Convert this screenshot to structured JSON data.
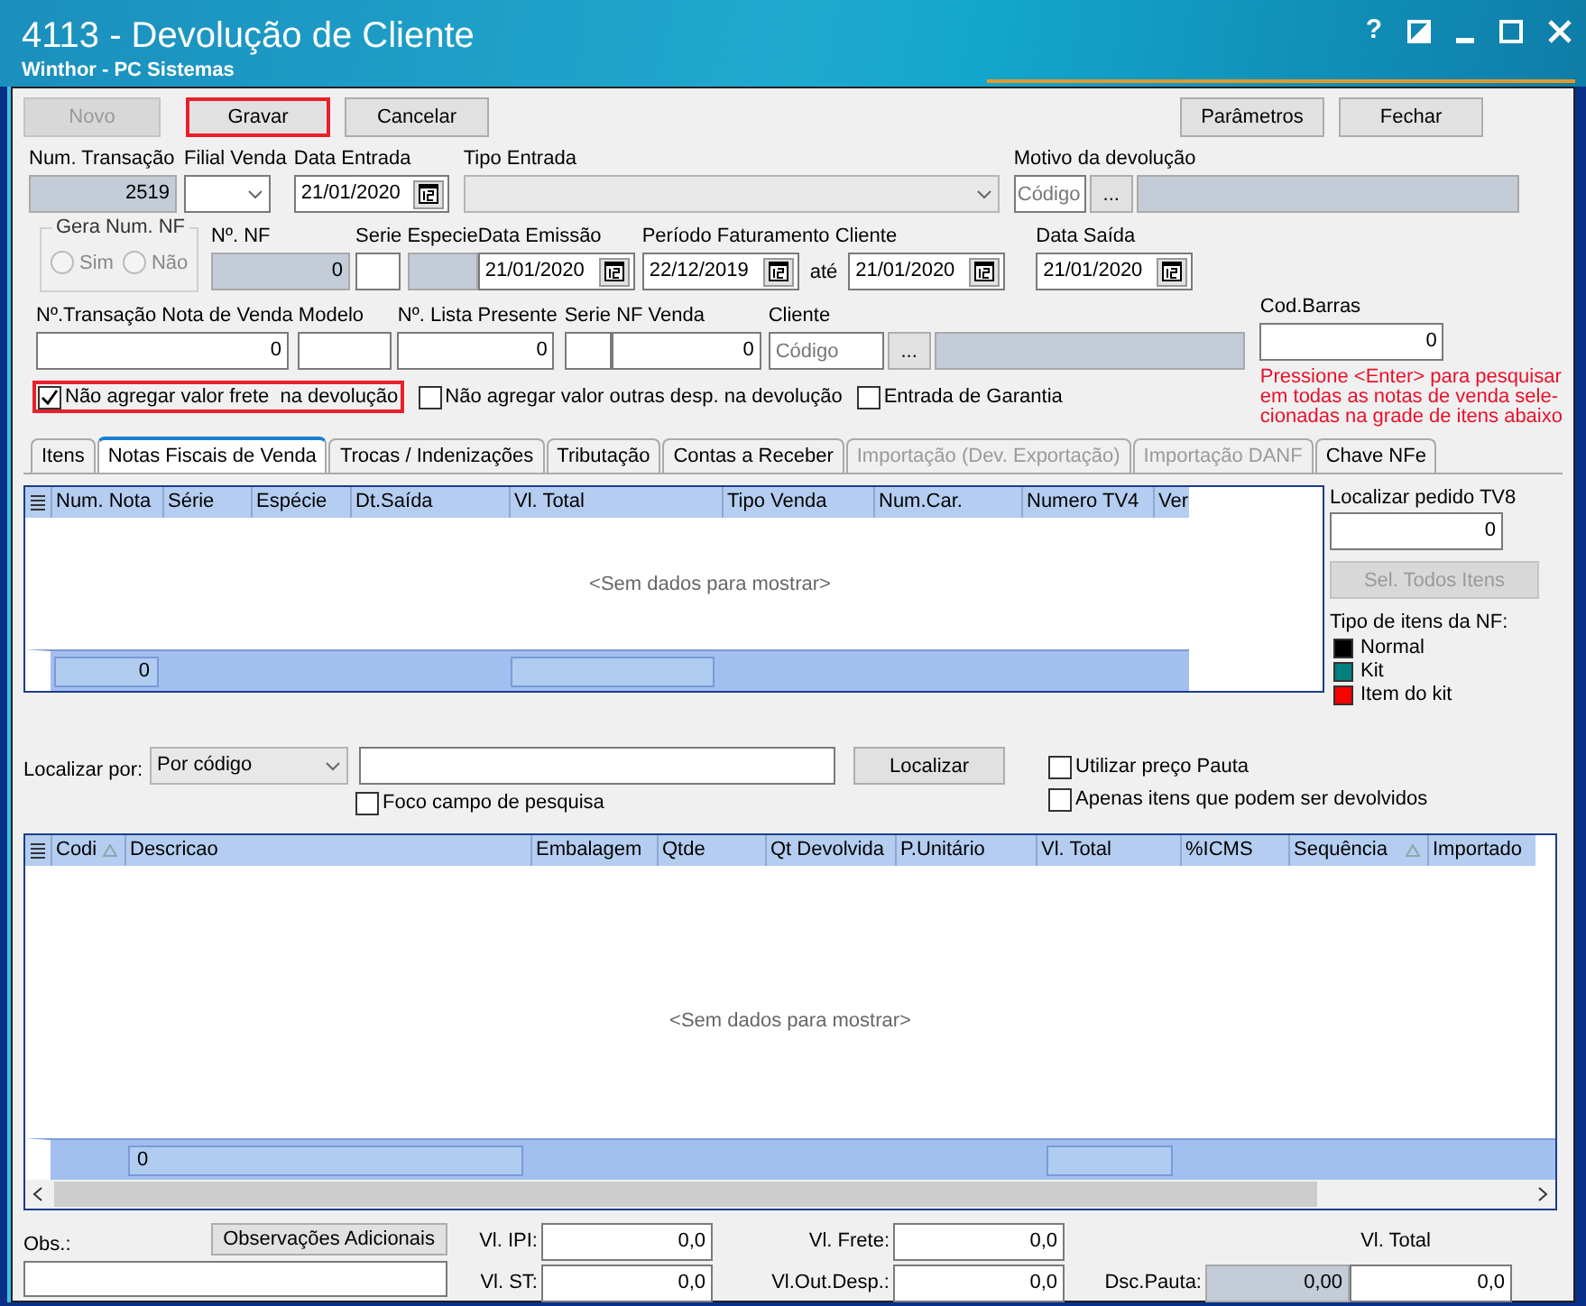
{
  "window": {
    "title": "4113 - Devolução de Cliente",
    "subtitle": "Winthor - PC Sistemas",
    "help": "?"
  },
  "toolbar": {
    "left": [
      {
        "label": "Novo",
        "disabled": true,
        "highlighted": false
      },
      {
        "label": "Gravar",
        "disabled": false,
        "highlighted": true
      },
      {
        "label": "Cancelar",
        "disabled": false,
        "highlighted": false
      }
    ],
    "right": [
      {
        "label": "Parâmetros",
        "disabled": false,
        "highlighted": false
      },
      {
        "label": "Fechar",
        "disabled": false,
        "highlighted": false
      }
    ]
  },
  "fields": {
    "num_transacao": {
      "label": "Num. Transação",
      "value": "2519"
    },
    "filial_venda": {
      "label": "Filial Venda"
    },
    "data_entrada": {
      "label": "Data Entrada",
      "value": "21/01/2020"
    },
    "tipo_entrada": {
      "label": "Tipo Entrada"
    },
    "motivo": {
      "label": "Motivo da devolução",
      "placeholder": "Código",
      "lookup": "..."
    },
    "gera_num_nf": {
      "label": "Gera Num. NF",
      "options": [
        {
          "label": "Sim",
          "selected": false
        },
        {
          "label": "Não",
          "selected": false
        }
      ]
    },
    "num_nf": {
      "label": "Nº. NF",
      "value": "0"
    },
    "serie": {
      "label": "Serie"
    },
    "especie": {
      "label": "Especie"
    },
    "data_emissao": {
      "label": "Data Emissão",
      "value": "21/01/2020"
    },
    "periodo": {
      "label": "Período Faturamento Cliente",
      "from": "22/12/2019",
      "separator": "até",
      "to": "21/01/2020"
    },
    "data_saida": {
      "label": "Data Saída",
      "value": "21/01/2020"
    },
    "transacao_nota_venda": {
      "label": "Nº.Transação Nota de Venda",
      "value": "0"
    },
    "modelo": {
      "label": "Modelo"
    },
    "lista_presente": {
      "label": "Nº. Lista Presente",
      "value": "0"
    },
    "serie_nf_venda": {
      "label": "Serie NF Venda",
      "value": "0"
    },
    "cliente": {
      "label": "Cliente",
      "placeholder": "Código",
      "lookup": "..."
    },
    "cod_barras": {
      "label": "Cod.Barras",
      "value": "0",
      "hint": [
        "Pressione <Enter> para pesquisar",
        "em todas as notas de venda sele-",
        "cionadas na grade de itens abaixo"
      ]
    }
  },
  "options": [
    {
      "label": "Não agregar valor frete  na devolução",
      "checked": true,
      "highlighted": true
    },
    {
      "label": "Não agregar valor outras desp. na devolução",
      "checked": false,
      "highlighted": false
    },
    {
      "label": "Entrada de Garantia",
      "checked": false,
      "highlighted": false
    }
  ],
  "tabs": [
    {
      "label": "Itens",
      "selected": false,
      "disabled": false
    },
    {
      "label": "Notas Fiscais de Venda",
      "selected": true,
      "disabled": false
    },
    {
      "label": "Trocas / Indenizações",
      "selected": false,
      "disabled": false
    },
    {
      "label": "Tributação",
      "selected": false,
      "disabled": false
    },
    {
      "label": "Contas a Receber",
      "selected": false,
      "disabled": false
    },
    {
      "label": "Importação (Dev. Exportação)",
      "selected": false,
      "disabled": true
    },
    {
      "label": "Importação DANF",
      "selected": false,
      "disabled": true
    },
    {
      "label": "Chave NFe",
      "selected": false,
      "disabled": false
    }
  ],
  "invoice_grid": {
    "columns": [
      "Num. Nota",
      "Série",
      "Espécie",
      "Dt.Saída",
      "Vl. Total",
      "Tipo Venda",
      "Num.Car.",
      "Numero TV4",
      "Ver"
    ],
    "empty_message": "<Sem dados para mostrar>",
    "footer_count": "0"
  },
  "side_panel": {
    "tv8": {
      "label": "Localizar pedido TV8",
      "value": "0"
    },
    "select_all": {
      "label": "Sel. Todos Itens",
      "disabled": true
    },
    "legend_title": "Tipo de itens da NF:",
    "legend": [
      {
        "label": "Normal",
        "color": "#000000"
      },
      {
        "label": "Kit",
        "color": "#008080"
      },
      {
        "label": "Item do kit",
        "color": "#ff0000"
      }
    ]
  },
  "search": {
    "label": "Localizar por:",
    "mode": "Por código",
    "button": "Localizar",
    "options": [
      {
        "label": "Foco campo de pesquisa",
        "checked": false
      },
      {
        "label": "Utilizar preço Pauta",
        "checked": false
      },
      {
        "label": "Apenas itens que podem ser devolvidos",
        "checked": false
      }
    ]
  },
  "items_grid": {
    "columns": [
      {
        "label": "Codi",
        "sorted": true
      },
      {
        "label": "Descricao",
        "sorted": false
      },
      {
        "label": "Embalagem",
        "sorted": false
      },
      {
        "label": "Qtde",
        "sorted": false
      },
      {
        "label": "Qt Devolvida",
        "sorted": false
      },
      {
        "label": "P.Unitário",
        "sorted": false
      },
      {
        "label": "Vl. Total",
        "sorted": false
      },
      {
        "label": "%ICMS",
        "sorted": false
      },
      {
        "label": "Sequência",
        "sorted": true
      },
      {
        "label": "Importado",
        "sorted": false
      }
    ],
    "empty_message": "<Sem dados para mostrar>",
    "footer_count": "0"
  },
  "totals": {
    "obs_label": "Obs.:",
    "obs_button": "Observações Adicionais",
    "vl_ipi": {
      "label": "Vl. IPI:",
      "value": "0,0"
    },
    "vl_st": {
      "label": "Vl. ST:",
      "value": "0,0"
    },
    "vl_frete": {
      "label": "Vl. Frete:",
      "value": "0,0"
    },
    "vl_out_desp": {
      "label": "Vl.Out.Desp.:",
      "value": "0,0"
    },
    "dsc_pauta": {
      "label": "Dsc.Pauta:",
      "value": "0,00"
    },
    "vl_total": {
      "label": "Vl. Total",
      "value": "0,0"
    }
  }
}
